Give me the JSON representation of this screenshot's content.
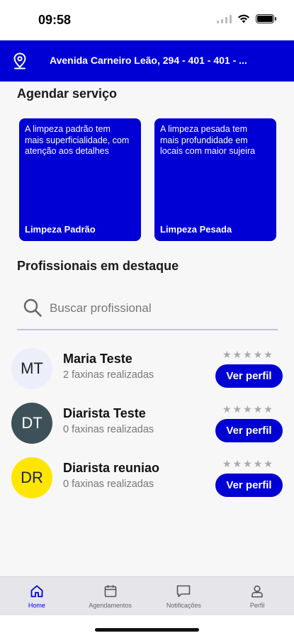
{
  "status_bar": {
    "time": "09:58"
  },
  "header": {
    "address": "Avenida Carneiro Leão, 294 - 401 - 401 - ..."
  },
  "schedule": {
    "title": "Agendar serviço",
    "cards": [
      {
        "description": "A limpeza padrão tem mais superficialidade, com atenção aos detalhes",
        "title": "Limpeza Padrão"
      },
      {
        "description": "A limpeza pesada tem mais profundidade em locais com maior sujeira",
        "title": "Limpeza Pesada"
      }
    ]
  },
  "featured": {
    "title": "Profissionais em destaque",
    "search_placeholder": "Buscar profissional",
    "professionals": [
      {
        "initials": "MT",
        "name": "Maria Teste",
        "count": "2 faxinas realizadas",
        "rating": 0,
        "avatar_bg": "#eceefa",
        "avatar_color": "#222222",
        "button": "Ver perfil"
      },
      {
        "initials": "DT",
        "name": "Diarista Teste",
        "count": "0 faxinas realizadas",
        "rating": 0,
        "avatar_bg": "#3f5158",
        "avatar_color": "#ffffff",
        "button": "Ver perfil"
      },
      {
        "initials": "DR",
        "name": "Diarista reuniao",
        "count": "0 faxinas realizadas",
        "rating": 0,
        "avatar_bg": "#ffe600",
        "avatar_color": "#222222",
        "button": "Ver perfil"
      }
    ]
  },
  "tab_bar": {
    "tabs": [
      {
        "label": "Home",
        "icon": "home-icon",
        "active": true
      },
      {
        "label": "Agendamentos",
        "icon": "calendar-icon",
        "active": false
      },
      {
        "label": "Notificações",
        "icon": "chat-icon",
        "active": false
      },
      {
        "label": "Perfil",
        "icon": "user-icon",
        "active": false
      }
    ]
  },
  "colors": {
    "brand": "#0000d4",
    "star_empty": "#a9a9a9"
  }
}
